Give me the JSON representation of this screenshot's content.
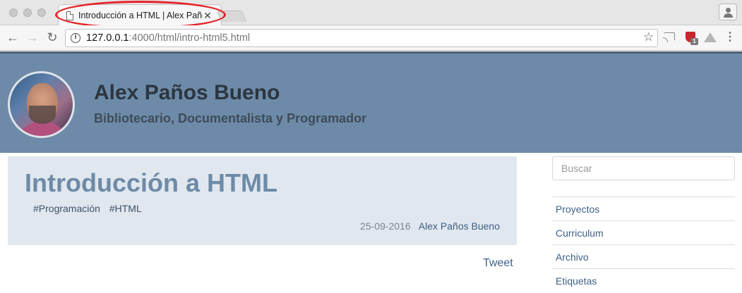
{
  "browser": {
    "tab_title": "Introducción a HTML | Alex Paños Bueno",
    "tab_close": "✕",
    "url_host": "127.0.0.1",
    "url_rest": ":4000/html/intro-html5.html",
    "icons": [
      "document-icon",
      "close-icon",
      "back-arrow-icon",
      "forward-arrow-icon",
      "reload-icon",
      "info-icon",
      "star-icon",
      "cast-icon",
      "shield-icon",
      "cloud-icon",
      "menu-icon",
      "profile-icon"
    ],
    "extension_badge": "1",
    "highlight_color": "#e6232a"
  },
  "header": {
    "title": "Alex Paños Bueno",
    "subtitle": "Bibliotecario, Documentalista y Programador",
    "background_color": "#6d8ba8"
  },
  "post": {
    "title": "Introducción a HTML",
    "tags": [
      "#Programación",
      "#HTML"
    ],
    "date": "25-09-2016",
    "author": "Alex Paños Bueno",
    "tweet_label": "Tweet"
  },
  "sidebar": {
    "search_placeholder": "Buscar",
    "items": [
      {
        "label": "Proyectos"
      },
      {
        "label": "Curriculum"
      },
      {
        "label": "Archivo"
      },
      {
        "label": "Etiquetas"
      }
    ]
  }
}
